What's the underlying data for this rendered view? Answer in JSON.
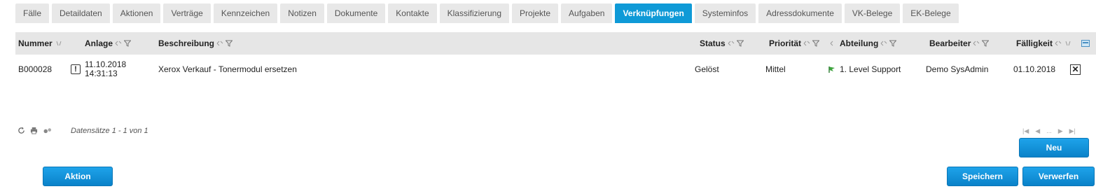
{
  "tabs": [
    {
      "label": "Fälle",
      "active": false
    },
    {
      "label": "Detaildaten",
      "active": false
    },
    {
      "label": "Aktionen",
      "active": false
    },
    {
      "label": "Verträge",
      "active": false
    },
    {
      "label": "Kennzeichen",
      "active": false
    },
    {
      "label": "Notizen",
      "active": false
    },
    {
      "label": "Dokumente",
      "active": false
    },
    {
      "label": "Kontakte",
      "active": false
    },
    {
      "label": "Klassifizierung",
      "active": false
    },
    {
      "label": "Projekte",
      "active": false
    },
    {
      "label": "Aufgaben",
      "active": false
    },
    {
      "label": "Verknüpfungen",
      "active": true
    },
    {
      "label": "Systeminfos",
      "active": false
    },
    {
      "label": "Adressdokumente",
      "active": false
    },
    {
      "label": "VK-Belege",
      "active": false
    },
    {
      "label": "EK-Belege",
      "active": false
    }
  ],
  "grid": {
    "columns": {
      "nummer": "Nummer",
      "anlage": "Anlage",
      "beschreibung": "Beschreibung",
      "status": "Status",
      "prioritaet": "Priorität",
      "abteilung": "Abteilung",
      "bearbeiter": "Bearbeiter",
      "faelligkeit": "Fälligkeit"
    },
    "rows": [
      {
        "nummer": "B000028",
        "anlage_date": "11.10.2018",
        "anlage_time": "14:31:13",
        "beschreibung": "Xerox Verkauf - Tonermodul ersetzen",
        "status": "Gelöst",
        "prioritaet": "Mittel",
        "abteilung": "1. Level Support",
        "bearbeiter": "Demo SysAdmin",
        "faelligkeit": "01.10.2018"
      }
    ]
  },
  "footer": {
    "records": "Datensätze 1 - 1 von 1"
  },
  "buttons": {
    "neu": "Neu",
    "aktion": "Aktion",
    "speichern": "Speichern",
    "verwerfen": "Verwerfen"
  },
  "colors": {
    "accent": "#0f9ad7",
    "tab_bg": "#e8e8e8",
    "header_bg": "#e6e6e6",
    "flag": "#2e8b2e"
  }
}
